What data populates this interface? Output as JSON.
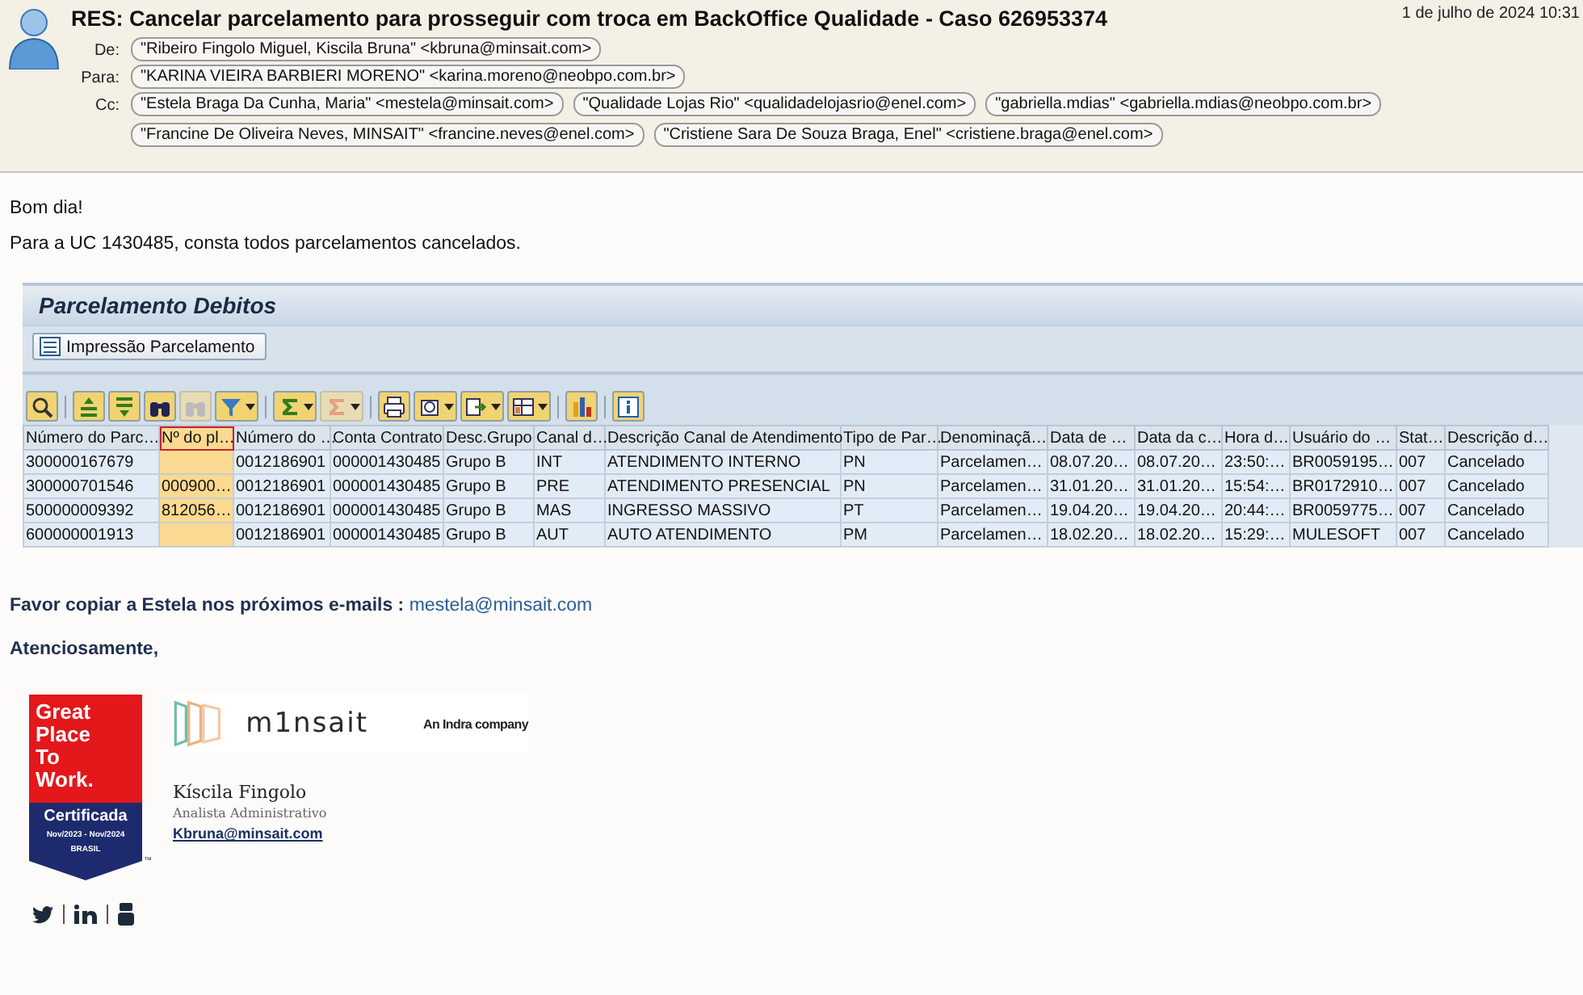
{
  "email": {
    "title": "RES: Cancelar parcelamento para prosseguir com troca em BackOffice Qualidade - Caso 626953374",
    "date": "1 de julho de 2024 10:31",
    "fields": [
      {
        "label": "De:",
        "recipients": [
          "\"Ribeiro Fingolo Miguel, Kiscila Bruna\" <kbruna@minsait.com>"
        ]
      },
      {
        "label": "Para:",
        "recipients": [
          "\"KARINA VIEIRA BARBIERI MORENO\" <karina.moreno@neobpo.com.br>"
        ]
      },
      {
        "label": "Cc:",
        "recipients": [
          "\"Estela Braga Da Cunha, Maria\" <mestela@minsait.com>",
          "\"Qualidade Lojas Rio\" <qualidadelojasrio@enel.com>",
          "\"gabriella.mdias\" <gabriella.mdias@neobpo.com.br>",
          "\"Francine De Oliveira Neves, MINSAIT\" <francine.neves@enel.com>",
          "\"Cristiene Sara De Souza Braga, Enel\" <cristiene.braga@enel.com>"
        ]
      }
    ]
  },
  "body": {
    "greeting": "Bom dia!",
    "paragraph": "Para a UC 1430485, consta todos parcelamentos cancelados."
  },
  "sap": {
    "title": "Parcelamento Debitos",
    "button": "Impressão Parcelamento",
    "columns": [
      {
        "label": "Número do Parc…",
        "selected": false
      },
      {
        "label": "Nº do pl…",
        "selected": true
      },
      {
        "label": "Número do …",
        "selected": false
      },
      {
        "label": "Conta Contrato",
        "selected": false
      },
      {
        "label": "Desc.Grupo",
        "selected": false
      },
      {
        "label": "Canal d…",
        "selected": false
      },
      {
        "label": "Descrição Canal de Atendimento",
        "selected": false
      },
      {
        "label": "Tipo de Par…",
        "selected": false
      },
      {
        "label": "Denominaçã…",
        "selected": false
      },
      {
        "label": "Data de …",
        "selected": false
      },
      {
        "label": "Data da c…",
        "selected": false
      },
      {
        "label": "Hora d…",
        "selected": false
      },
      {
        "label": "Usuário do …",
        "selected": false
      },
      {
        "label": "Stat…",
        "selected": false
      },
      {
        "label": "Descrição d…",
        "selected": false
      }
    ],
    "rows": [
      [
        "300000167679",
        "",
        "0012186901",
        "000001430485",
        "Grupo B",
        "INT",
        "ATENDIMENTO INTERNO",
        "PN",
        "Parcelamen…",
        "08.07.20…",
        "08.07.20…",
        "23:50:…",
        "BR0059195…",
        "007",
        "Cancelado"
      ],
      [
        "300000701546",
        "000900…",
        "0012186901",
        "000001430485",
        "Grupo B",
        "PRE",
        "ATENDIMENTO PRESENCIAL",
        "PN",
        "Parcelamen…",
        "31.01.20…",
        "31.01.20…",
        "15:54:…",
        "BR0172910…",
        "007",
        "Cancelado"
      ],
      [
        "500000009392",
        "812056…",
        "0012186901",
        "000001430485",
        "Grupo B",
        "MAS",
        "INGRESSO MASSIVO",
        "PT",
        "Parcelamen…",
        "19.04.20…",
        "19.04.20…",
        "20:44:…",
        "BR0059775…",
        "007",
        "Cancelado"
      ],
      [
        "600000001913",
        "",
        "0012186901",
        "000001430485",
        "Grupo B",
        "AUT",
        "AUTO ATENDIMENTO",
        "PM",
        "Parcelamen…",
        "18.02.20…",
        "18.02.20…",
        "15:29:…",
        "MULESOFT",
        "007",
        "Cancelado"
      ]
    ]
  },
  "note": {
    "text": "Favor copiar a Estela nos próximos e-mails : ",
    "link": "mestela@minsait.com"
  },
  "closing": "Atenciosamente,",
  "signature": {
    "badge": {
      "lines": [
        "Great",
        "Place",
        "To",
        "Work."
      ],
      "certified": "Certificada",
      "period": "Nov/2023 - Nov/2024",
      "country": "BRASIL",
      "mark": "™"
    },
    "logo": {
      "brand": "m1nsait",
      "tagline": "An Indra company"
    },
    "name": "Kíscila Fingolo",
    "role": "Analista Administrativo",
    "email": "Kbruna@minsait.com"
  }
}
